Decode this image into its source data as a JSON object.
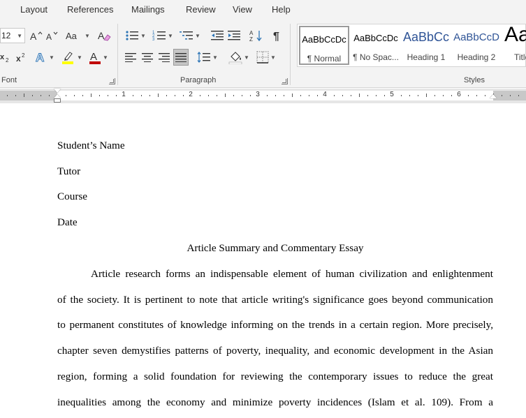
{
  "menu": {
    "tabs": [
      "Layout",
      "References",
      "Mailings",
      "Review",
      "View",
      "Help"
    ]
  },
  "ribbon": {
    "font": {
      "size_value": "12",
      "group_label": "Font"
    },
    "paragraph": {
      "group_label": "Paragraph"
    },
    "styles": {
      "group_label": "Styles",
      "items": [
        {
          "preview": "AaBbCcDc",
          "name": "¶ Normal",
          "selected": true
        },
        {
          "preview": "AaBbCcDc",
          "name": "¶ No Spac..."
        },
        {
          "preview": "AaBbCc",
          "name": "Heading 1"
        },
        {
          "preview": "AaBbCcD",
          "name": "Heading 2"
        },
        {
          "preview": "Aa",
          "name": "Title"
        }
      ]
    }
  },
  "ruler": {
    "numbers": [
      "1",
      "2",
      "3",
      "4",
      "5",
      "6"
    ]
  },
  "document": {
    "header_lines": [
      "Student’s Name",
      "Tutor",
      "Course",
      "Date"
    ],
    "title": "Article Summary and Commentary Essay",
    "body_lines": [
      "Article research forms an indispensable element of human civilization and enlightenment",
      "of the society. It is pertinent to note that article writing's significance goes beyond communication",
      "to permanent constitutes of knowledge informing on the trends in a certain region. More precisely,",
      "chapter seven demystifies patterns of poverty, inequality, and economic development in the Asian",
      "region, forming a solid foundation for reviewing the contemporary issues to reduce the great",
      "inequalities among the economy and minimize poverty incidences (Islam et al. 109). From a"
    ]
  },
  "colors": {
    "ribbon_bg": "#f3f3f3",
    "highlight_yellow": "#ffff00",
    "font_color_red": "#c00000",
    "heading_blue": "#2f5496"
  }
}
